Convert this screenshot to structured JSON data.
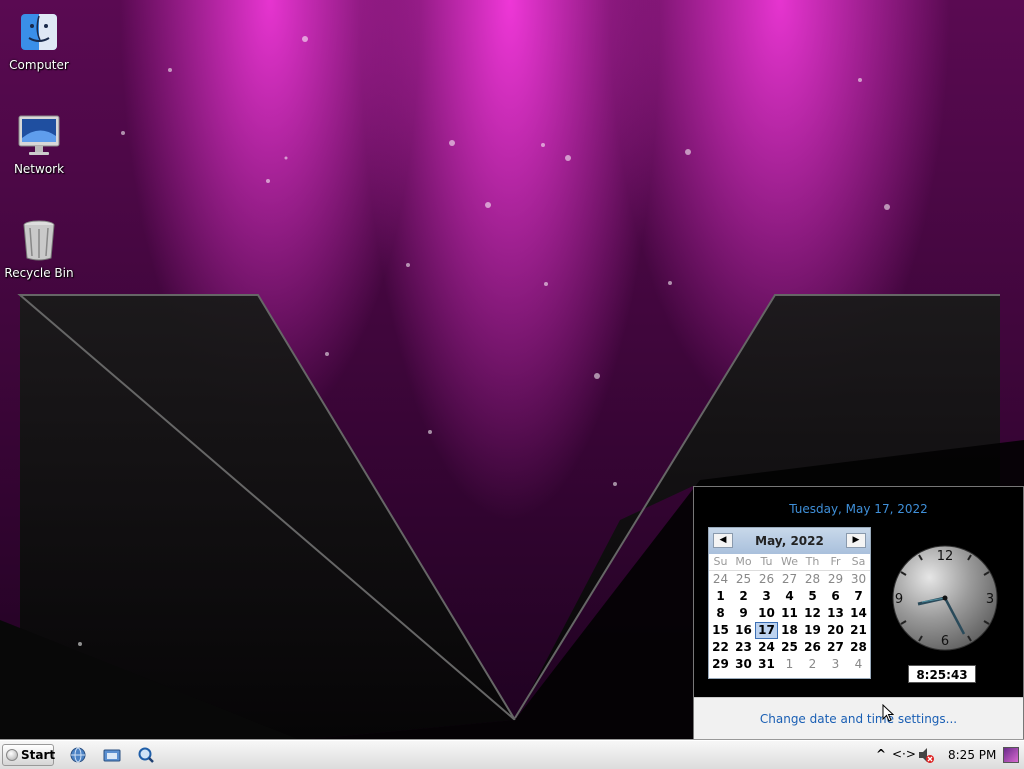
{
  "desktop": {
    "icons": [
      {
        "label": "Computer",
        "icon": "finder-icon"
      },
      {
        "label": "Network",
        "icon": "monitor-icon"
      },
      {
        "label": "Recycle Bin",
        "icon": "trash-icon"
      }
    ]
  },
  "flyout": {
    "date_heading": "Tuesday, May 17, 2022",
    "calendar": {
      "title": "May, 2022",
      "weekdays": [
        "Su",
        "Mo",
        "Tu",
        "We",
        "Th",
        "Fr",
        "Sa"
      ],
      "weeks": [
        [
          "24",
          "25",
          "26",
          "27",
          "28",
          "29",
          "30"
        ],
        [
          "1",
          "2",
          "3",
          "4",
          "5",
          "6",
          "7"
        ],
        [
          "8",
          "9",
          "10",
          "11",
          "12",
          "13",
          "14"
        ],
        [
          "15",
          "16",
          "17",
          "18",
          "19",
          "20",
          "21"
        ],
        [
          "22",
          "23",
          "24",
          "25",
          "26",
          "27",
          "28"
        ],
        [
          "29",
          "30",
          "31",
          "1",
          "2",
          "3",
          "4"
        ]
      ],
      "selected_day": "17"
    },
    "clock": {
      "numerals": [
        "12",
        "3",
        "6",
        "9"
      ],
      "time_text": "8:25:43 PM"
    },
    "settings_link": "Change date and time settings..."
  },
  "taskbar": {
    "start_label": "Start",
    "quick_launch": [
      "browser-icon",
      "folder-icon",
      "search-icon"
    ],
    "tray": {
      "show_hidden": "^",
      "network": "<·>",
      "time": "8:25 PM"
    }
  },
  "colors": {
    "accent": "#3f8fd8",
    "wallpaper": "#4a0845",
    "highlight": "#bcd2ef"
  }
}
